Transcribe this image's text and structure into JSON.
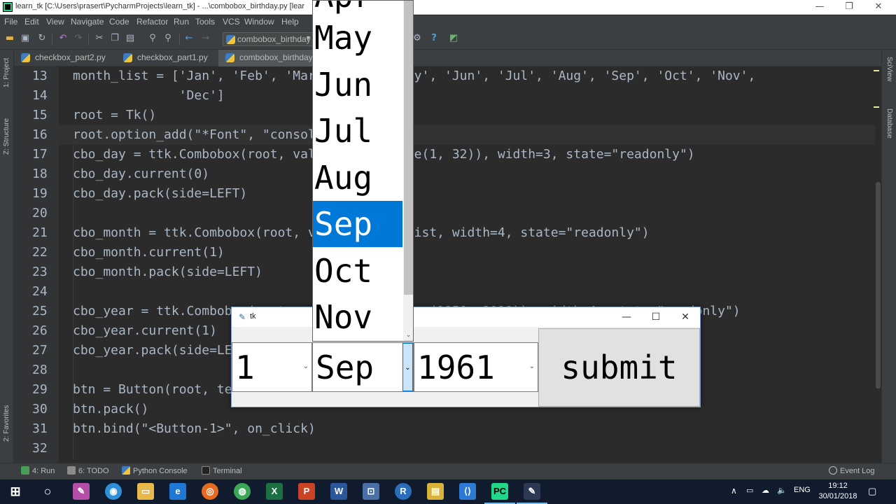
{
  "titlebar": {
    "title": "learn_tk [C:\\Users\\prasert\\PycharmProjects\\learn_tk] - ...\\combobox_birthday.py [lear",
    "minimize": "—",
    "maximize": "❐",
    "close": "✕"
  },
  "menu": [
    "File",
    "Edit",
    "View",
    "Navigate",
    "Code",
    "Refactor",
    "Run",
    "Tools",
    "VCS",
    "Window",
    "Help"
  ],
  "toolbar": {
    "run_config": "combobox_birthday",
    "help_icon": "?"
  },
  "tabs": [
    {
      "label": "checkbox_part2.py",
      "active": false
    },
    {
      "label": "checkbox_part1.py",
      "active": false
    },
    {
      "label": "combobox_birthday",
      "active": true
    }
  ],
  "left_strip": {
    "project": "1: Project",
    "structure": "Z: Structure",
    "favorites": "2: Favorites"
  },
  "right_strip": {
    "sciview": "SciView",
    "database": "Database"
  },
  "editor": {
    "line_numbers": [
      "13",
      "14",
      "15",
      "16",
      "17",
      "18",
      "19",
      "20",
      "21",
      "22",
      "23",
      "24",
      "25",
      "26",
      "27",
      "28",
      "29",
      "30",
      "31",
      "32"
    ]
  },
  "tk_window": {
    "title": "tk",
    "minimize": "—",
    "maximize": "☐",
    "close": "✕",
    "day_value": "1",
    "month_value": "Sep",
    "year_value": "1961",
    "submit_label": "submit",
    "arrow": "⌄"
  },
  "dropdown": {
    "options": [
      "Apr",
      "May",
      "Jun",
      "Jul",
      "Aug",
      "Sep",
      "Oct",
      "Nov"
    ],
    "selected": "Sep",
    "down_arrow": "⌄"
  },
  "bottombar": {
    "run": "4: Run",
    "todo": "6: TODO",
    "python_console": "Python Console",
    "terminal": "Terminal",
    "event_log": "Event Log"
  },
  "taskbar": {
    "language": "ENG",
    "time": "19:12",
    "date": "30/01/2018"
  },
  "colors": {
    "editor_bg": "#2b2b2b",
    "keyword": "#cc7832",
    "string": "#6a8759",
    "number": "#6897bb",
    "selection": "#0078d7"
  }
}
